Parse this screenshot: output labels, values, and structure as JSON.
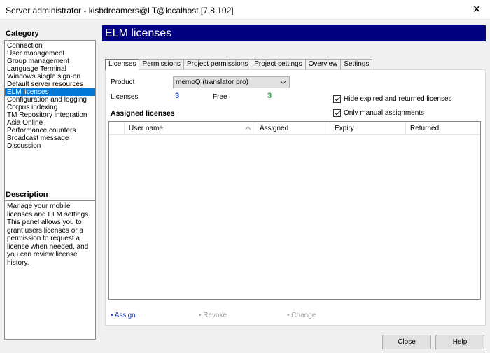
{
  "window": {
    "title": "Server administrator - kisbdreamers@LT@localhost [7.8.102]",
    "close_glyph": "✕"
  },
  "category": {
    "heading": "Category",
    "items": [
      "Connection",
      "User management",
      "Group management",
      "Language Terminal",
      "Windows single sign-on",
      "Default server resources",
      "ELM licenses",
      "Configuration and logging",
      "Corpus indexing",
      "TM Repository integration",
      "Asia Online",
      "Performance counters",
      "Broadcast message",
      "Discussion"
    ],
    "selected_index": 6
  },
  "description": {
    "heading": "Description",
    "text": "Manage your mobile licenses and ELM settings. This panel allows you to grant users licenses or a permission to request a license when needed, and you can review license history."
  },
  "page": {
    "title": "ELM licenses"
  },
  "tabs": [
    "Licenses",
    "Permissions",
    "Project permissions",
    "Project settings",
    "Overview",
    "Settings"
  ],
  "form": {
    "product_label": "Product",
    "product_value": "memoQ (translator pro)",
    "licenses_label": "Licenses",
    "licenses_count": "3",
    "free_label": "Free",
    "free_count": "3",
    "hide_expired_label": "Hide expired and returned licenses",
    "hide_expired_checked": true,
    "only_manual_label": "Only manual assignments",
    "only_manual_checked": true
  },
  "assigned": {
    "title": "Assigned licenses",
    "columns": [
      "",
      "User name",
      "Assigned",
      "Expiry",
      "Returned"
    ],
    "rows": []
  },
  "actions": {
    "assign": "• Assign",
    "revoke": "• Revoke",
    "change": "• Change"
  },
  "buttons": {
    "close": "Close",
    "help": "Help"
  },
  "colors": {
    "header_bg": "#000080",
    "selection": "#0078d7",
    "link": "#1f3cc8",
    "free_count": "#2ca24a"
  }
}
